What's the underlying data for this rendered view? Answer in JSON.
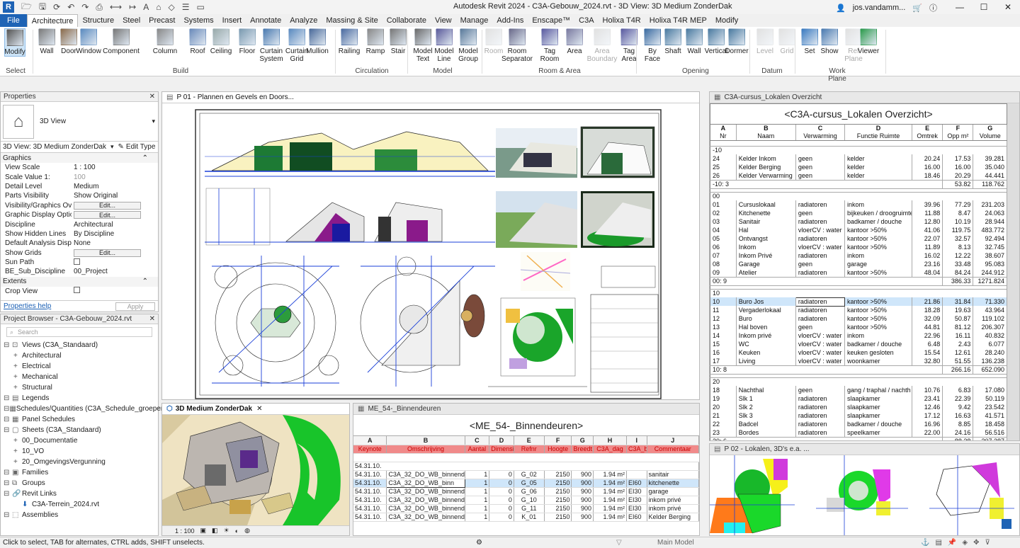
{
  "app": {
    "title": "Autodesk Revit 2024 - C3A-Gebouw_2024.rvt - 3D View: 3D Medium ZonderDak",
    "user": "jos.vandamm...",
    "logo": "R"
  },
  "tabs": [
    "File",
    "Architecture",
    "Structure",
    "Steel",
    "Precast",
    "Systems",
    "Insert",
    "Annotate",
    "Analyze",
    "Massing & Site",
    "Collaborate",
    "View",
    "Manage",
    "Add-Ins",
    "Enscape™",
    "C3A",
    "Holixa T4R",
    "Holixa T4R MEP",
    "Modify"
  ],
  "ribbon": {
    "buttons": [
      {
        "label": "Modify",
        "icon": "cursor-icon",
        "state": "selected"
      },
      {
        "label": "Wall",
        "icon": "wall-icon"
      },
      {
        "label": "Door",
        "icon": "door-icon"
      },
      {
        "label": "Window",
        "icon": "window-icon"
      },
      {
        "label": "Component",
        "icon": "component-icon"
      },
      {
        "label": "Column",
        "icon": "column-icon"
      },
      {
        "label": "Roof",
        "icon": "roof-icon"
      },
      {
        "label": "Ceiling",
        "icon": "ceiling-icon"
      },
      {
        "label": "Floor",
        "icon": "floor-icon"
      },
      {
        "label": "Curtain System",
        "icon": "curtain-system-icon"
      },
      {
        "label": "Curtain Grid",
        "icon": "curtain-grid-icon"
      },
      {
        "label": "Mullion",
        "icon": "mullion-icon"
      },
      {
        "label": "Railing",
        "icon": "railing-icon"
      },
      {
        "label": "Ramp",
        "icon": "ramp-icon"
      },
      {
        "label": "Stair",
        "icon": "stair-icon"
      },
      {
        "label": "Model Text",
        "icon": "model-text-icon"
      },
      {
        "label": "Model Line",
        "icon": "model-line-icon"
      },
      {
        "label": "Model Group",
        "icon": "model-group-icon"
      },
      {
        "label": "Room",
        "icon": "room-icon",
        "state": "disabled"
      },
      {
        "label": "Room Separator",
        "icon": "room-separator-icon"
      },
      {
        "label": "Tag Room",
        "icon": "tag-room-icon"
      },
      {
        "label": "Area",
        "icon": "area-icon"
      },
      {
        "label": "Area Boundary",
        "icon": "area-boundary-icon",
        "state": "disabled"
      },
      {
        "label": "Tag Area",
        "icon": "tag-area-icon"
      },
      {
        "label": "By Face",
        "icon": "by-face-icon"
      },
      {
        "label": "Shaft",
        "icon": "shaft-icon"
      },
      {
        "label": "Wall",
        "icon": "wall-opening-icon"
      },
      {
        "label": "Vertical",
        "icon": "vertical-icon"
      },
      {
        "label": "Dormer",
        "icon": "dormer-icon"
      },
      {
        "label": "Level",
        "icon": "level-icon",
        "state": "disabled"
      },
      {
        "label": "Grid",
        "icon": "grid-icon",
        "state": "disabled"
      },
      {
        "label": "Set",
        "icon": "set-icon"
      },
      {
        "label": "Show",
        "icon": "show-icon"
      },
      {
        "label": "Ref Plane",
        "icon": "ref-plane-icon",
        "state": "disabled"
      },
      {
        "label": "Viewer",
        "icon": "viewer-icon"
      }
    ],
    "panels": [
      "Select",
      "Build",
      "Circulation",
      "Model",
      "Room & Area",
      "Opening",
      "Datum",
      "Work Plane"
    ]
  },
  "properties": {
    "title": "Properties",
    "type": "3D View",
    "selector": "3D View: 3D Medium ZonderDak",
    "edit_type": "Edit Type",
    "section_graphics": "Graphics",
    "rows": [
      {
        "k": "View Scale",
        "v": "1 : 100"
      },
      {
        "k": "Scale Value    1:",
        "v": "100",
        "dim": true
      },
      {
        "k": "Detail Level",
        "v": "Medium"
      },
      {
        "k": "Parts Visibility",
        "v": "Show Original"
      },
      {
        "k": "Visibility/Graphics Ov...",
        "btn": "Edit..."
      },
      {
        "k": "Graphic Display Optio...",
        "btn": "Edit..."
      },
      {
        "k": "Discipline",
        "v": "Architectural"
      },
      {
        "k": "Show Hidden Lines",
        "v": "By Discipline"
      },
      {
        "k": "Default Analysis Displ...",
        "v": "None"
      },
      {
        "k": "Show Grids",
        "btn": "Edit..."
      },
      {
        "k": "Sun Path",
        "chk": true
      },
      {
        "k": "BE_Sub_Discipline",
        "v": "00_Project"
      }
    ],
    "section_extents": "Extents",
    "crop_view": "Crop View",
    "help": "Properties help",
    "apply": "Apply"
  },
  "browser": {
    "title": "Project Browser - C3A-Gebouw_2024.rvt",
    "search": "Search",
    "items": [
      {
        "t": "Views (C3A_Standaard)",
        "l": 0,
        "ic": "views-icon"
      },
      {
        "t": "Architectural",
        "l": 1
      },
      {
        "t": "Electrical",
        "l": 1
      },
      {
        "t": "Mechanical",
        "l": 1
      },
      {
        "t": "Structural",
        "l": 1
      },
      {
        "t": "Legends",
        "l": 0,
        "ic": "legends-icon"
      },
      {
        "t": "Schedules/Quantities (C3A_Schedule_groepen)",
        "l": 0,
        "ic": "schedules-icon"
      },
      {
        "t": "Panel Schedules",
        "l": 0,
        "ic": "panel-schedules-icon"
      },
      {
        "t": "Sheets (C3A_Standaard)",
        "l": 0,
        "ic": "sheets-icon"
      },
      {
        "t": "00_Documentatie",
        "l": 1
      },
      {
        "t": "10_VO",
        "l": 1
      },
      {
        "t": "20_OmgevingsVergunning",
        "l": 1
      },
      {
        "t": "Families",
        "l": 0,
        "ic": "families-icon"
      },
      {
        "t": "Groups",
        "l": 0,
        "ic": "groups-icon"
      },
      {
        "t": "Revit Links",
        "l": 0,
        "ic": "revit-links-icon"
      },
      {
        "t": "C3A-Terrein_2024.rvt",
        "l": 1,
        "ic": "link-arrow-icon"
      },
      {
        "t": "Assemblies",
        "l": 0,
        "ic": "assemblies-icon"
      }
    ]
  },
  "views": {
    "sheet_tab": "P 01 - Plannen en Gevels en Doors...",
    "view3d_tab": "3D Medium ZonderDak",
    "view3d_scale": "1 : 100",
    "sched_tab": "ME_54-_Binnendeuren",
    "lokalen_tab": "C3A-cursus_Lokalen Overzicht",
    "p02_tab": "P 02 - Lokalen, 3D's e.a. ..."
  },
  "lokalen": {
    "title": "<C3A-cursus_Lokalen Overzicht>",
    "letters": [
      "A",
      "B",
      "C",
      "D",
      "E",
      "F",
      "G"
    ],
    "headers": [
      "Nr",
      "Naam",
      "Verwarming",
      "Functie Ruimte",
      "Omtrek",
      "Opp m²",
      "Volume"
    ],
    "rows": [
      {
        "type": "group",
        "c": [
          "-10"
        ]
      },
      {
        "c": [
          "24",
          "Kelder Inkom",
          "geen",
          "kelder",
          "20.24",
          "17.53",
          "39.281"
        ]
      },
      {
        "c": [
          "25",
          "Kelder Berging",
          "geen",
          "kelder",
          "16.00",
          "16.00",
          "35.040"
        ]
      },
      {
        "c": [
          "26",
          "Kelder Verwarming",
          "geen",
          "kelder",
          "18.46",
          "20.29",
          "44.441"
        ]
      },
      {
        "type": "sub",
        "c": [
          "-10: 3",
          "",
          "",
          "",
          "",
          "53.82",
          "118.762"
        ]
      },
      {
        "type": "group",
        "c": [
          "00"
        ]
      },
      {
        "c": [
          "01",
          "Cursuslokaal",
          "radiatoren",
          "inkom",
          "39.96",
          "77.29",
          "231.203"
        ]
      },
      {
        "c": [
          "02",
          "Kitchenette",
          "geen",
          "bijkeuken / droogruimte",
          "11.88",
          "8.47",
          "24.063"
        ]
      },
      {
        "c": [
          "03",
          "Sanitair",
          "radiatoren",
          "badkamer / douche",
          "12.80",
          "10.19",
          "28.944"
        ]
      },
      {
        "c": [
          "04",
          "Hal",
          "vloerCV : water",
          "kantoor >50%",
          "41.06",
          "119.75",
          "483.772"
        ]
      },
      {
        "c": [
          "05",
          "Ontvangst",
          "radiatoren",
          "kantoor >50%",
          "22.07",
          "32.57",
          "92.494"
        ]
      },
      {
        "c": [
          "06",
          "Inkom",
          "vloerCV : water",
          "kantoor >50%",
          "11.89",
          "8.13",
          "32.745"
        ]
      },
      {
        "c": [
          "07",
          "Inkom Privé",
          "radiatoren",
          "inkom",
          "16.02",
          "12.22",
          "38.607"
        ]
      },
      {
        "c": [
          "08",
          "Garage",
          "geen",
          "garage",
          "23.16",
          "33.48",
          "95.083"
        ]
      },
      {
        "c": [
          "09",
          "Atelier",
          "radiatoren",
          "kantoor >50%",
          "48.04",
          "84.24",
          "244.912"
        ]
      },
      {
        "type": "sub",
        "c": [
          "00: 9",
          "",
          "",
          "",
          "",
          "386.33",
          "1271.824"
        ]
      },
      {
        "type": "group",
        "c": [
          "10"
        ]
      },
      {
        "type": "sel",
        "c": [
          "10",
          "Buro Jos",
          "radiatoren",
          "kantoor >50%",
          "21.86",
          "31.84",
          "71.330"
        ]
      },
      {
        "c": [
          "11",
          "Vergaderlokaal",
          "radiatoren",
          "kantoor >50%",
          "18.28",
          "19.63",
          "43.964"
        ]
      },
      {
        "c": [
          "12",
          "Buro",
          "radiatoren",
          "kantoor >50%",
          "32.09",
          "50.87",
          "119.102"
        ]
      },
      {
        "c": [
          "13",
          "Hal boven",
          "geen",
          "kantoor >50%",
          "44.81",
          "81.12",
          "206.307"
        ]
      },
      {
        "c": [
          "14",
          "Inkom privé",
          "vloerCV : water",
          "inkom",
          "22.96",
          "16.11",
          "40.832"
        ]
      },
      {
        "c": [
          "15",
          "WC",
          "vloerCV : water",
          "badkamer / douche",
          "6.48",
          "2.43",
          "6.077"
        ]
      },
      {
        "c": [
          "16",
          "Keuken",
          "vloerCV : water",
          "keuken gesloten",
          "15.54",
          "12.61",
          "28.240"
        ]
      },
      {
        "c": [
          "17",
          "Living",
          "vloerCV : water",
          "woonkamer",
          "32.80",
          "51.55",
          "136.238"
        ]
      },
      {
        "type": "sub",
        "c": [
          "10: 8",
          "",
          "",
          "",
          "",
          "266.16",
          "652.090"
        ]
      },
      {
        "type": "group",
        "c": [
          "20"
        ]
      },
      {
        "c": [
          "18",
          "Nachthal",
          "geen",
          "gang / traphal / nachth",
          "10.76",
          "6.83",
          "17.080"
        ]
      },
      {
        "c": [
          "19",
          "Slk 1",
          "radiatoren",
          "slaapkamer",
          "23.41",
          "22.39",
          "50.119"
        ]
      },
      {
        "c": [
          "20",
          "Slk 2",
          "radiatoren",
          "slaapkamer",
          "12.46",
          "9.42",
          "23.542"
        ]
      },
      {
        "c": [
          "21",
          "Slk 3",
          "radiatoren",
          "slaapkamer",
          "17.12",
          "16.63",
          "41.571"
        ]
      },
      {
        "c": [
          "22",
          "Badcel",
          "radiatoren",
          "badkamer / douche",
          "16.96",
          "8.85",
          "18.458"
        ]
      },
      {
        "c": [
          "23",
          "Bordes",
          "radiatoren",
          "speelkamer",
          "22.00",
          "24.16",
          "56.516"
        ]
      },
      {
        "type": "sub",
        "c": [
          "20: 6",
          "",
          "",
          "",
          "",
          "88.28",
          "207.287"
        ]
      }
    ]
  },
  "deuren": {
    "title": "<ME_54-_Binnendeuren>",
    "letters": [
      "A",
      "B",
      "C",
      "D",
      "E",
      "F",
      "G",
      "H",
      "I",
      "J"
    ],
    "headers": [
      "Keynote",
      "Omschrijving",
      "Aantal",
      "Dimensi",
      "Refnr",
      "Hoogte",
      "Breedt",
      "C3A_dag",
      "C3A_br",
      "Commentaar"
    ],
    "rows": [
      {
        "type": "group",
        "c": [
          "54.31.10."
        ]
      },
      {
        "c": [
          "54.31.10.",
          "C3A_32_DO_WB_binnend",
          "1",
          "0",
          "G_02",
          "2150",
          "900",
          "1.94 m²",
          "",
          "sanitair"
        ]
      },
      {
        "type": "sel",
        "c": [
          "54.31.10.",
          "C3A_32_DO_WB_binn",
          "1",
          "0",
          "G_05",
          "2150",
          "900",
          "1.94 m²",
          "EI60",
          "kitchenette"
        ]
      },
      {
        "c": [
          "54.31.10.",
          "C3A_32_DO_WB_binnend",
          "1",
          "0",
          "G_06",
          "2150",
          "900",
          "1.94 m²",
          "EI30",
          "garage"
        ]
      },
      {
        "c": [
          "54.31.10.",
          "C3A_32_DO_WB_binnend",
          "1",
          "0",
          "G_10",
          "2150",
          "900",
          "1.94 m²",
          "EI30",
          "inkom privé"
        ]
      },
      {
        "c": [
          "54.31.10.",
          "C3A_32_DO_WB_binnend",
          "1",
          "0",
          "G_11",
          "2150",
          "900",
          "1.94 m²",
          "EI30",
          "inkom privé"
        ]
      },
      {
        "c": [
          "54.31.10.",
          "C3A_32_DO_WB_binnend",
          "1",
          "0",
          "K_01",
          "2150",
          "900",
          "1.94 m²",
          "EI60",
          "Kelder Berging"
        ]
      }
    ]
  },
  "status": {
    "left": "Click to select, TAB for alternates, CTRL adds, SHIFT unselects.",
    "model": "Main Model"
  }
}
